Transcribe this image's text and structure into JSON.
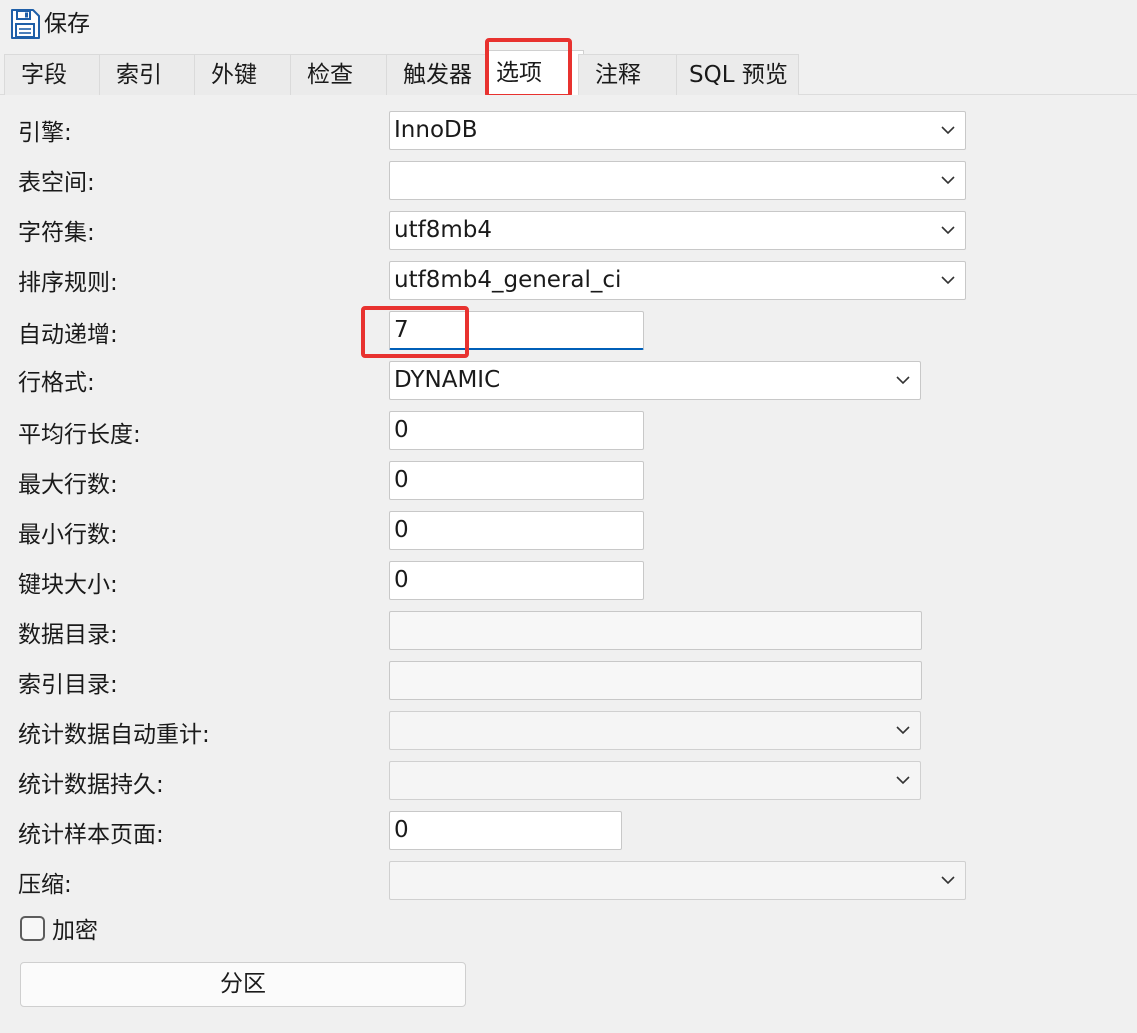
{
  "toolbar": {
    "save_label": "保存",
    "save_icon": "floppy-disk-icon"
  },
  "tabs": [
    {
      "label": "字段"
    },
    {
      "label": "索引"
    },
    {
      "label": "外键"
    },
    {
      "label": "检查"
    },
    {
      "label": "触发器"
    },
    {
      "label": "选项",
      "active": true
    },
    {
      "label": "注释"
    },
    {
      "label": "SQL 预览"
    }
  ],
  "highlight_color": "#e8322f",
  "form": {
    "engine": {
      "label": "引擎:",
      "value": "InnoDB"
    },
    "tablespace": {
      "label": "表空间:",
      "value": ""
    },
    "charset": {
      "label": "字符集:",
      "value": "utf8mb4"
    },
    "collation": {
      "label": "排序规则:",
      "value": "utf8mb4_general_ci"
    },
    "auto_increment": {
      "label": "自动递增:",
      "value": "7"
    },
    "row_format": {
      "label": "行格式:",
      "value": "DYNAMIC"
    },
    "avg_row_length": {
      "label": "平均行长度:",
      "value": "0"
    },
    "max_rows": {
      "label": "最大行数:",
      "value": "0"
    },
    "min_rows": {
      "label": "最小行数:",
      "value": "0"
    },
    "key_block_size": {
      "label": "键块大小:",
      "value": "0"
    },
    "data_directory": {
      "label": "数据目录:",
      "value": ""
    },
    "index_directory": {
      "label": "索引目录:",
      "value": ""
    },
    "stats_auto_recalc": {
      "label": "统计数据自动重计:",
      "value": ""
    },
    "stats_persistent": {
      "label": "统计数据持久:",
      "value": ""
    },
    "stats_sample_pages": {
      "label": "统计样本页面:",
      "value": "0"
    },
    "compression": {
      "label": "压缩:",
      "value": ""
    },
    "encryption": {
      "label": "加密",
      "checked": false
    },
    "partition_button": "分区"
  }
}
